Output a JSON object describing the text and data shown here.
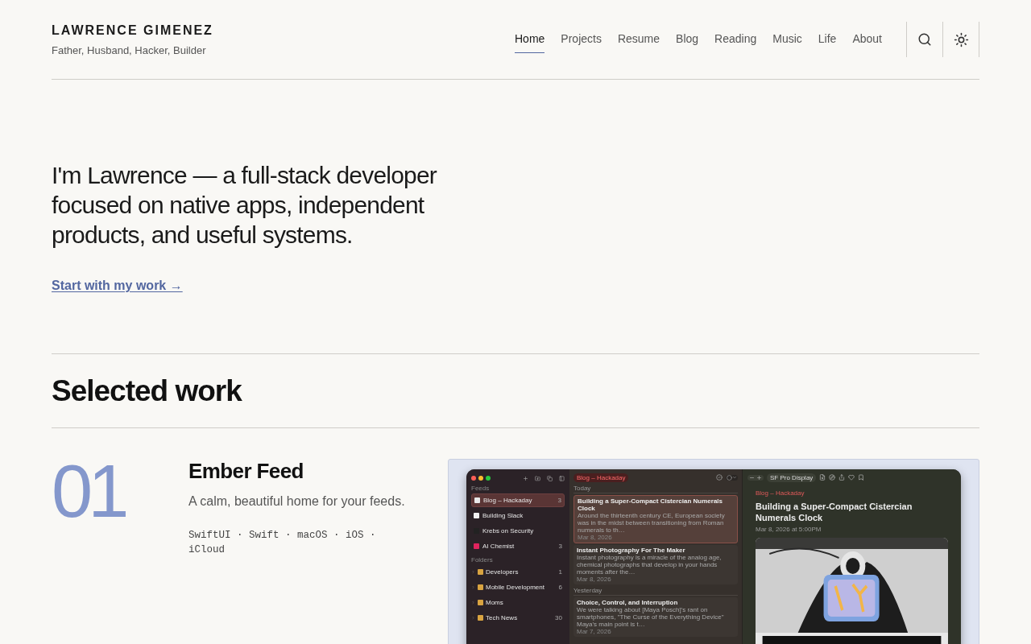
{
  "site": {
    "name": "LAWRENCE GIMENEZ",
    "tagline": "Father, Husband, Hacker, Builder"
  },
  "nav": [
    {
      "label": "Home",
      "selected": true
    },
    {
      "label": "Projects",
      "selected": false
    },
    {
      "label": "Resume",
      "selected": false
    },
    {
      "label": "Blog",
      "selected": false
    },
    {
      "label": "Reading",
      "selected": false
    },
    {
      "label": "Music",
      "selected": false
    },
    {
      "label": "Life",
      "selected": false
    },
    {
      "label": "About",
      "selected": false
    }
  ],
  "hero": {
    "text": "I'm Lawrence — a full-stack developer focused on native apps, independent products, and useful systems.",
    "link": "Start with my work →"
  },
  "section_title": "Selected work",
  "projects": [
    {
      "number": "01",
      "title": "Ember Feed",
      "description": "A calm, beautiful home for your feeds.",
      "tags": "SwiftUI · Swift · macOS · iOS · iCloud",
      "screenshot": {
        "sidebar": {
          "feeds_header": "Feeds",
          "folders_header": "Folders",
          "feeds": [
            {
              "name": "Blog – Hackaday",
              "count": "3",
              "selected": true
            },
            {
              "name": "Building Slack",
              "selected": false
            },
            {
              "name": "Krebs on Security",
              "selected": false
            },
            {
              "name": "AI Chemist",
              "count": "3",
              "selected": false
            }
          ],
          "folders": [
            {
              "name": "Developers",
              "count": "1",
              "expanded": false
            },
            {
              "name": "Mobile Development",
              "count": "6",
              "expanded": false
            },
            {
              "name": "Moms",
              "expanded": false
            },
            {
              "name": "Tech News",
              "count": "30",
              "expanded": false
            }
          ]
        },
        "list": {
          "title": "Blog – Hackaday",
          "groups": [
            {
              "label": "Today",
              "articles": [
                {
                  "title": "Building a Super-Compact Cistercian Numerals Clock",
                  "snippet": "Around the thirteenth century CE, European society was in the midst between transitioning from Roman numerals to th…",
                  "date": "Mar 8, 2026",
                  "selected": true
                },
                {
                  "title": "Instant Photography For The Maker",
                  "snippet": "Instant photography is a miracle of the analog age, chemical photographs that develop in your hands moments after the…",
                  "date": "Mar 8, 2026",
                  "selected": false
                }
              ]
            },
            {
              "label": "Yesterday",
              "articles": [
                {
                  "title": "Choice, Control, and Interruption",
                  "snippet": "We were talking about [Maya Posch]'s rant on smartphones, \"The Curse of the Everything Device\" Maya's main point is t…",
                  "date": "Mar 7, 2026",
                  "selected": false
                }
              ]
            }
          ]
        },
        "reader": {
          "font": "SF Pro Display",
          "source": "Blog – Hackaday",
          "title": "Building a Super-Compact Cistercian Numerals Clock",
          "date": "Mar 8, 2026 at 5:00PM"
        }
      }
    }
  ]
}
